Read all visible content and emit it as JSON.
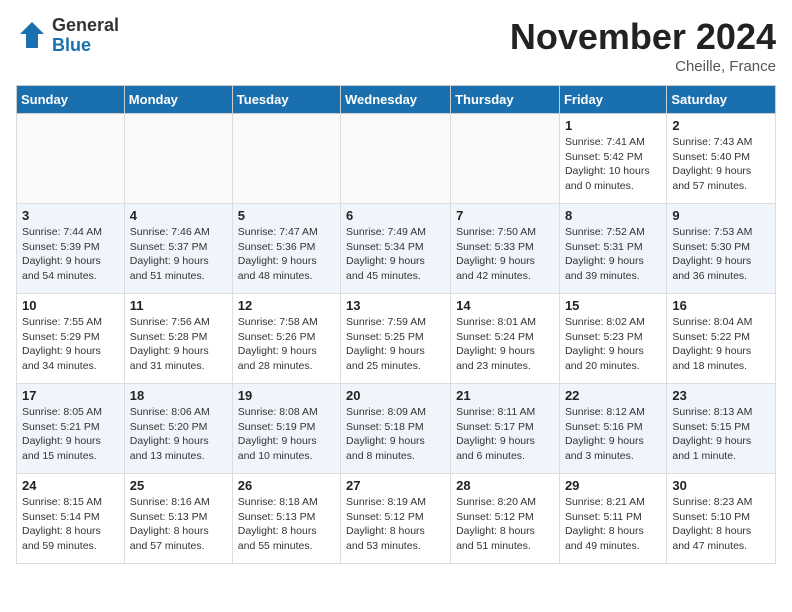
{
  "logo": {
    "general": "General",
    "blue": "Blue"
  },
  "title": "November 2024",
  "location": "Cheille, France",
  "weekdays": [
    "Sunday",
    "Monday",
    "Tuesday",
    "Wednesday",
    "Thursday",
    "Friday",
    "Saturday"
  ],
  "weeks": [
    [
      {
        "day": "",
        "info": ""
      },
      {
        "day": "",
        "info": ""
      },
      {
        "day": "",
        "info": ""
      },
      {
        "day": "",
        "info": ""
      },
      {
        "day": "",
        "info": ""
      },
      {
        "day": "1",
        "info": "Sunrise: 7:41 AM\nSunset: 5:42 PM\nDaylight: 10 hours\nand 0 minutes."
      },
      {
        "day": "2",
        "info": "Sunrise: 7:43 AM\nSunset: 5:40 PM\nDaylight: 9 hours\nand 57 minutes."
      }
    ],
    [
      {
        "day": "3",
        "info": "Sunrise: 7:44 AM\nSunset: 5:39 PM\nDaylight: 9 hours\nand 54 minutes."
      },
      {
        "day": "4",
        "info": "Sunrise: 7:46 AM\nSunset: 5:37 PM\nDaylight: 9 hours\nand 51 minutes."
      },
      {
        "day": "5",
        "info": "Sunrise: 7:47 AM\nSunset: 5:36 PM\nDaylight: 9 hours\nand 48 minutes."
      },
      {
        "day": "6",
        "info": "Sunrise: 7:49 AM\nSunset: 5:34 PM\nDaylight: 9 hours\nand 45 minutes."
      },
      {
        "day": "7",
        "info": "Sunrise: 7:50 AM\nSunset: 5:33 PM\nDaylight: 9 hours\nand 42 minutes."
      },
      {
        "day": "8",
        "info": "Sunrise: 7:52 AM\nSunset: 5:31 PM\nDaylight: 9 hours\nand 39 minutes."
      },
      {
        "day": "9",
        "info": "Sunrise: 7:53 AM\nSunset: 5:30 PM\nDaylight: 9 hours\nand 36 minutes."
      }
    ],
    [
      {
        "day": "10",
        "info": "Sunrise: 7:55 AM\nSunset: 5:29 PM\nDaylight: 9 hours\nand 34 minutes."
      },
      {
        "day": "11",
        "info": "Sunrise: 7:56 AM\nSunset: 5:28 PM\nDaylight: 9 hours\nand 31 minutes."
      },
      {
        "day": "12",
        "info": "Sunrise: 7:58 AM\nSunset: 5:26 PM\nDaylight: 9 hours\nand 28 minutes."
      },
      {
        "day": "13",
        "info": "Sunrise: 7:59 AM\nSunset: 5:25 PM\nDaylight: 9 hours\nand 25 minutes."
      },
      {
        "day": "14",
        "info": "Sunrise: 8:01 AM\nSunset: 5:24 PM\nDaylight: 9 hours\nand 23 minutes."
      },
      {
        "day": "15",
        "info": "Sunrise: 8:02 AM\nSunset: 5:23 PM\nDaylight: 9 hours\nand 20 minutes."
      },
      {
        "day": "16",
        "info": "Sunrise: 8:04 AM\nSunset: 5:22 PM\nDaylight: 9 hours\nand 18 minutes."
      }
    ],
    [
      {
        "day": "17",
        "info": "Sunrise: 8:05 AM\nSunset: 5:21 PM\nDaylight: 9 hours\nand 15 minutes."
      },
      {
        "day": "18",
        "info": "Sunrise: 8:06 AM\nSunset: 5:20 PM\nDaylight: 9 hours\nand 13 minutes."
      },
      {
        "day": "19",
        "info": "Sunrise: 8:08 AM\nSunset: 5:19 PM\nDaylight: 9 hours\nand 10 minutes."
      },
      {
        "day": "20",
        "info": "Sunrise: 8:09 AM\nSunset: 5:18 PM\nDaylight: 9 hours\nand 8 minutes."
      },
      {
        "day": "21",
        "info": "Sunrise: 8:11 AM\nSunset: 5:17 PM\nDaylight: 9 hours\nand 6 minutes."
      },
      {
        "day": "22",
        "info": "Sunrise: 8:12 AM\nSunset: 5:16 PM\nDaylight: 9 hours\nand 3 minutes."
      },
      {
        "day": "23",
        "info": "Sunrise: 8:13 AM\nSunset: 5:15 PM\nDaylight: 9 hours\nand 1 minute."
      }
    ],
    [
      {
        "day": "24",
        "info": "Sunrise: 8:15 AM\nSunset: 5:14 PM\nDaylight: 8 hours\nand 59 minutes."
      },
      {
        "day": "25",
        "info": "Sunrise: 8:16 AM\nSunset: 5:13 PM\nDaylight: 8 hours\nand 57 minutes."
      },
      {
        "day": "26",
        "info": "Sunrise: 8:18 AM\nSunset: 5:13 PM\nDaylight: 8 hours\nand 55 minutes."
      },
      {
        "day": "27",
        "info": "Sunrise: 8:19 AM\nSunset: 5:12 PM\nDaylight: 8 hours\nand 53 minutes."
      },
      {
        "day": "28",
        "info": "Sunrise: 8:20 AM\nSunset: 5:12 PM\nDaylight: 8 hours\nand 51 minutes."
      },
      {
        "day": "29",
        "info": "Sunrise: 8:21 AM\nSunset: 5:11 PM\nDaylight: 8 hours\nand 49 minutes."
      },
      {
        "day": "30",
        "info": "Sunrise: 8:23 AM\nSunset: 5:10 PM\nDaylight: 8 hours\nand 47 minutes."
      }
    ]
  ]
}
